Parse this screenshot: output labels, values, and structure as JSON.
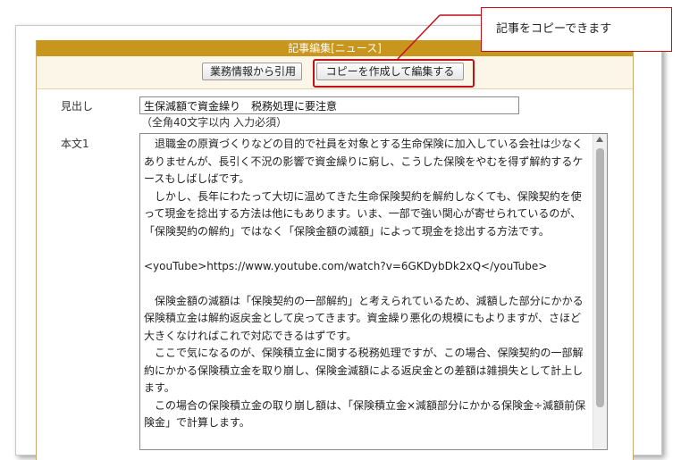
{
  "panel": {
    "title": "記事編集[ニュース]"
  },
  "toolbar": {
    "quote_label": "業務情報から引用",
    "copy_label": "コピーを作成して編集する"
  },
  "callout": {
    "text": "記事をコピーできます",
    "color": "#c0101a"
  },
  "form": {
    "headline_label": "見出し",
    "headline_value": "生保減額で資金繰り　税務処理に要注意",
    "headline_hint": "（全角40文字以内 入力必須）",
    "body_label": "本文1",
    "body_value": "　退職金の原資づくりなどの目的で社員を対象とする生命保険に加入している会社は少なくありませんが、長引く不況の影響で資金繰りに窮し、こうした保険をやむを得ず解約するケースもしばしばです。\n　しかし、長年にわたって大切に温めてきた生命保険契約を解約しなくても、保険契約を使って現金を捻出する方法は他にもあります。いま、一部で強い関心が寄せられているのが、「保険契約の解約」ではなく「保険金額の減額」によって現金を捻出する方法です。\n\n<youTube>https://www.youtube.com/watch?v=6GKDybDk2xQ</youTube>\n\n　保険金額の減額は「保険契約の一部解約」と考えられているため、減額した部分にかかる保険積立金は解約返戻金として戻ってきます。資金繰り悪化の規模にもよりますが、さほど大きくなければこれで対応できるはずです。\n　ここで気になるのが、保険積立金に関する税務処理ですが、この場合、保険契約の一部解約にかかる保険積立金を取り崩し、保険金減額による返戻金との差額は雑損失として計上します。\n　この場合の保険積立金の取り崩し額は、「保険積立金×減額部分にかかる保険金÷減額前保険金」で計算します。"
  },
  "colors": {
    "header_bg": "#c8951d",
    "toolbar_bg": "#fbf6e8"
  }
}
